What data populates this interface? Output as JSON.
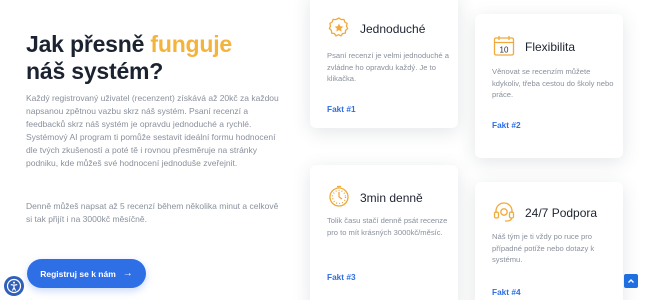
{
  "section": {
    "heading_part1": "Jak přesně ",
    "heading_accent": "funguje",
    "heading_part2": "náš systém?",
    "intro": "Každý registrovaný uživatel (recenzent) získává až 20kč za každou napsanou zpětnou vazbu skrz náš systém. Psaní recenzí a feedbacků skrz náš systém je opravdu jednoduché a rychlé. Systémový AI program ti pomůže sestavit ideální formu hodnocení dle tvých zkušeností a poté tě i rovnou přesměruje na stránky podniku, kde můžeš své hodnocení jednoduše zveřejnit.",
    "intro2": "Denně můžeš napsat až 5 recenzí během několika minut a celkově si tak přijít i na 3000kč měsíčně.",
    "cta_label": "Registruj se k nám",
    "cta_arrow": "→"
  },
  "cards": [
    {
      "title": "Jednoduché",
      "desc": "Psaní recenzí je velmi jednoduché a zvládne ho opravdu každý. Je to klikačka.",
      "fakt": "Fakt #1",
      "icon": "badge-star-icon"
    },
    {
      "title": "Flexibilita",
      "desc": "Věnovat se recenzím můžete kdykoliv, třeba cestou do školy nebo práce.",
      "fakt": "Fakt #2",
      "icon": "calendar-icon"
    },
    {
      "title": "3min denně",
      "desc": "Tolik času stačí denně psát recenze pro to mít krásných 3000kč/měsíc.",
      "fakt": "Fakt #3",
      "icon": "stopwatch-icon"
    },
    {
      "title": "24/7 Podpora",
      "desc": "Náš tým je ti vždy po ruce pro případné potíže nebo dotazy k systému.",
      "fakt": "Fakt #4",
      "icon": "headset-icon"
    }
  ],
  "colors": {
    "accent": "#f4b33d",
    "primary": "#2f6fe6"
  },
  "widgets": {
    "accessibility_icon": "accessibility-icon",
    "scroll_top_icon": "chevron-up-icon"
  }
}
